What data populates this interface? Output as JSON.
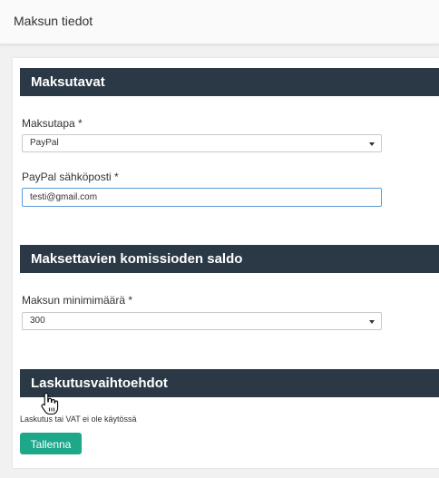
{
  "page": {
    "title": "Maksun tiedot"
  },
  "sections": {
    "payment_method": {
      "header": "Maksutavat",
      "method_label": "Maksutapa *",
      "method_value": "PayPal",
      "email_label": "PayPal sähköposti *",
      "email_value": "testi@gmail.com"
    },
    "commission_balance": {
      "header": "Maksettavien komissioden saldo",
      "minimum_label": "Maksun minimimäärä *",
      "minimum_value": "300"
    },
    "billing_options": {
      "header": "Laskutusvaihtoehdot",
      "note": "Laskutus tai VAT ei ole käytössä"
    }
  },
  "actions": {
    "save_label": "Tallenna"
  },
  "colors": {
    "header_bg": "#2b3947",
    "save_button": "#1da88a",
    "input_focus_border": "#5b9bd5"
  },
  "icons": {
    "select_caret": "caret-down-icon",
    "cursor": "hand-pointer-icon"
  }
}
